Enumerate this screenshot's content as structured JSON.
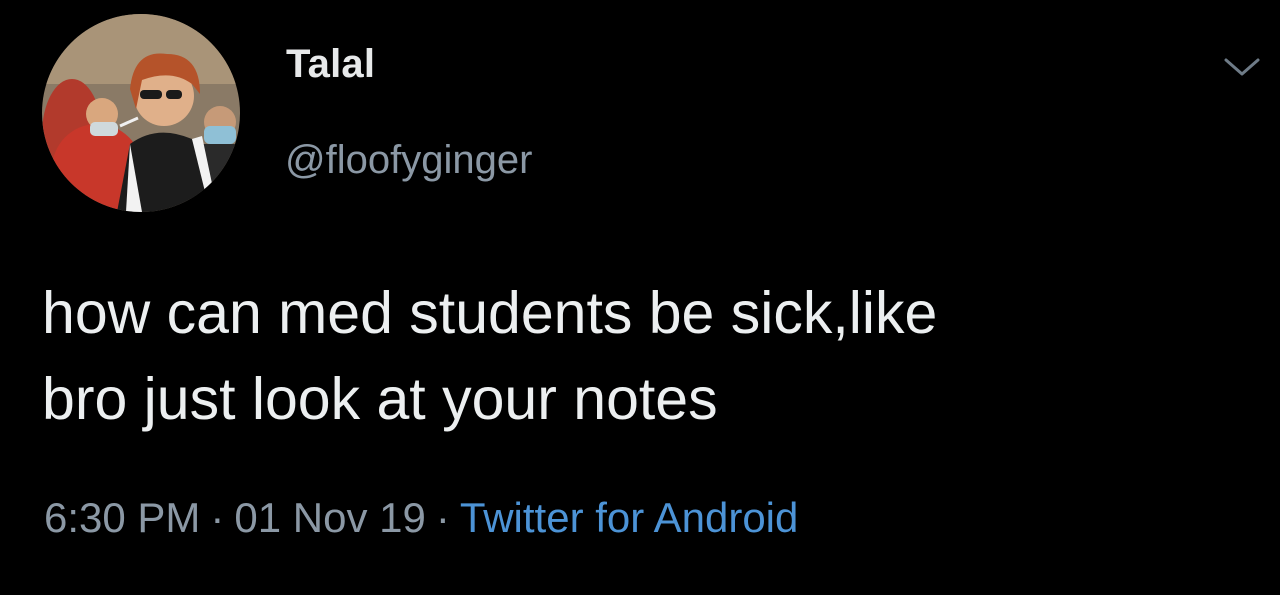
{
  "author": {
    "display_name": "Talal",
    "handle": "@floofyginger",
    "avatar_icon": "profile-photo"
  },
  "tweet": {
    "text": "how can med students be sick,like\nbro just look at your notes"
  },
  "meta": {
    "time": "6:30 PM",
    "separator": "·",
    "date": "01 Nov 19",
    "source": "Twitter for Android"
  },
  "menu": {
    "icon": "chevron-down-icon"
  },
  "colors": {
    "background": "#000000",
    "primary_text": "#e7e9ea",
    "secondary_text": "#8b98a5",
    "link": "#4c93d6"
  }
}
